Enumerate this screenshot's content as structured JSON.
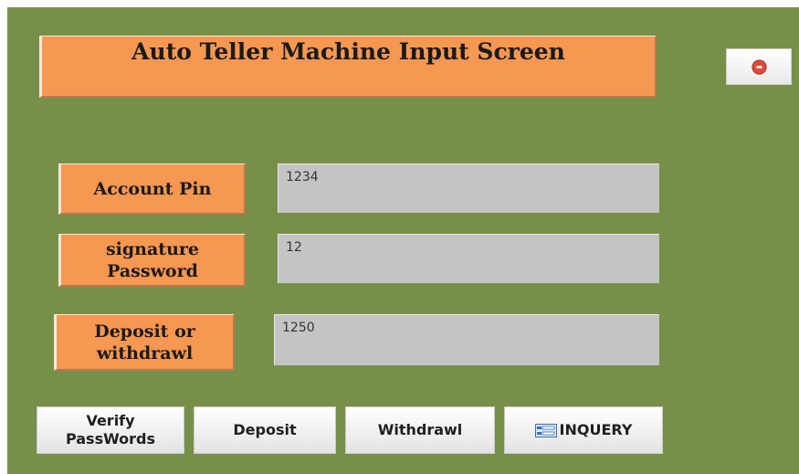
{
  "window": {
    "title": "Auto Teller Machine Input Screen"
  },
  "close_icon": "close-icon",
  "fields": [
    {
      "label": "Account Pin",
      "value": "1234"
    },
    {
      "label": "signature Password",
      "value": "12"
    },
    {
      "label": "Deposit or withdrawl",
      "value": "1250"
    }
  ],
  "buttons": {
    "verify": "Verify PassWords",
    "deposit": "Deposit",
    "withdrawl": "Withdrawl",
    "inquery": "INQUERY",
    "inquery_icon": "form-icon"
  },
  "colors": {
    "form_background": "#76904a",
    "label_background": "#f69752",
    "field_background": "#c4c4c4"
  }
}
